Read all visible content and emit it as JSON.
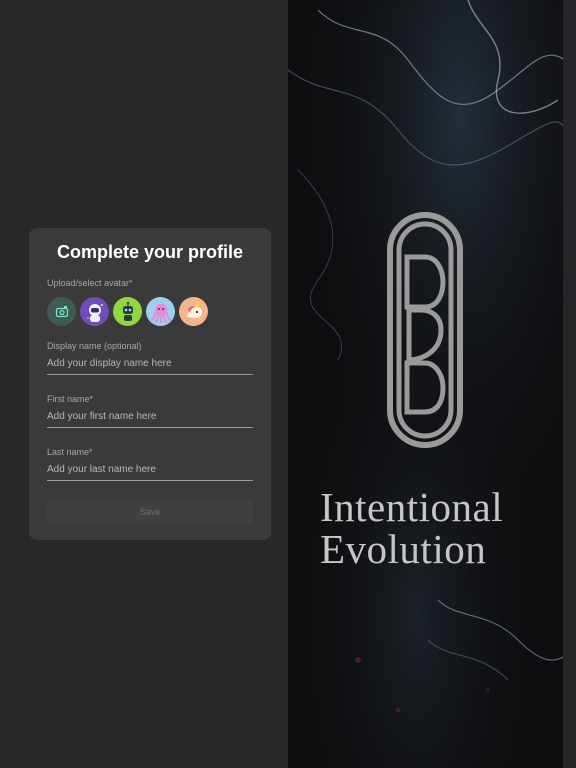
{
  "profile_form": {
    "title": "Complete your profile",
    "avatar_label": "Upload/select avatar*",
    "avatars": [
      {
        "icon": "upload-photo-icon",
        "bg": "#3f5b54"
      },
      {
        "icon": "astronaut-avatar-icon",
        "bg": "#6f4fb6"
      },
      {
        "icon": "robot-avatar-icon",
        "bg": "#8fd844"
      },
      {
        "icon": "octopus-avatar-icon",
        "bg": "#9fcff0"
      },
      {
        "icon": "unicorn-avatar-icon",
        "bg": "#f2b58d"
      }
    ],
    "display_name": {
      "label": "Display name (optional)",
      "placeholder": "Add your display name here",
      "value": ""
    },
    "first_name": {
      "label": "First name*",
      "placeholder": "Add your first name here",
      "value": ""
    },
    "last_name": {
      "label": "Last name*",
      "placeholder": "Add your last name here",
      "value": ""
    },
    "save_label": "Save"
  },
  "brand": {
    "line1": "Intentional",
    "line2": "Evolution",
    "logo": "intentional-evolution-logo"
  },
  "colors": {
    "background": "#282828",
    "card": "#3a3a3a",
    "brand_panel": "#0e0e10",
    "brand_text": "#c6c6c6"
  }
}
